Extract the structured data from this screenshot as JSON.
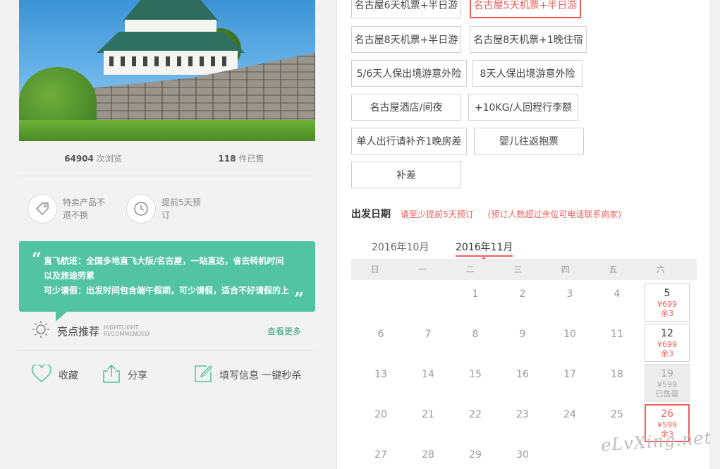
{
  "product": {
    "stats": {
      "views": "64904",
      "views_label": "次浏览",
      "sold": "118",
      "sold_label": "件已售"
    },
    "features": [
      {
        "icon": "tag-icon",
        "text": "特卖产品不退不换"
      },
      {
        "icon": "clock-icon",
        "text": "提前5天预订"
      }
    ],
    "quote_lines": [
      "直飞航班：全国多地直飞大阪/名古屋，一站直达，省去转机时间",
      "以及旅途劳累",
      "可少请假：出发时间包含端午假期，可少请假，适合不好请假的上"
    ],
    "highlight": {
      "title": "亮点推荐",
      "en1": "HIGHTLIGHT",
      "en2": "RECOMMENDED",
      "more": "查看更多"
    },
    "actions": {
      "favorite": "收藏",
      "share": "分享",
      "fill": "填写信息 一键秒杀"
    }
  },
  "options": [
    {
      "label": "名古屋6天机票+半日游",
      "selected": false
    },
    {
      "label": "名古屋5天机票+半日游",
      "selected": true
    },
    {
      "label": "名古屋8天机票+半日游",
      "selected": false
    },
    {
      "label": "名古屋8天机票+1晚住宿",
      "selected": false
    },
    {
      "label": "5/6天人保出境游意外险",
      "selected": false
    },
    {
      "label": "8天人保出境游意外险",
      "selected": false
    },
    {
      "label": "名古屋酒店/间夜",
      "selected": false
    },
    {
      "label": "+10KG/人回程行李额",
      "selected": false
    },
    {
      "label": "单人出行请补齐1晚房差",
      "selected": false
    },
    {
      "label": "婴儿往返抱票",
      "selected": false
    },
    {
      "label": "补差",
      "selected": false
    }
  ],
  "departure": {
    "title": "出发日期",
    "hint": "请至少提前5天预订",
    "hint2": "(预订人数超过余位可电话联系商家)",
    "months": [
      "2016年10月",
      "2016年11月"
    ],
    "active_month": "2016年11月",
    "weekdays": [
      "日",
      "一",
      "二",
      "三",
      "四",
      "五",
      "六"
    ],
    "days": [
      {
        "n": "1",
        "s": "none"
      },
      {
        "n": "2",
        "s": "none"
      },
      {
        "n": "3",
        "s": "none"
      },
      {
        "n": "4",
        "s": "none"
      },
      {
        "n": "5",
        "s": "avail",
        "price": "¥699",
        "left": "余3"
      },
      {
        "n": "6",
        "s": "none"
      },
      {
        "n": "7",
        "s": "none"
      },
      {
        "n": "8",
        "s": "none"
      },
      {
        "n": "9",
        "s": "none"
      },
      {
        "n": "10",
        "s": "none"
      },
      {
        "n": "11",
        "s": "none"
      },
      {
        "n": "12",
        "s": "avail",
        "price": "¥699",
        "left": "余3"
      },
      {
        "n": "13",
        "s": "none"
      },
      {
        "n": "14",
        "s": "none"
      },
      {
        "n": "15",
        "s": "none"
      },
      {
        "n": "16",
        "s": "none"
      },
      {
        "n": "17",
        "s": "none"
      },
      {
        "n": "18",
        "s": "none"
      },
      {
        "n": "19",
        "s": "sold",
        "price": "¥599",
        "left": "已售罄"
      },
      {
        "n": "20",
        "s": "none"
      },
      {
        "n": "21",
        "s": "none"
      },
      {
        "n": "22",
        "s": "none"
      },
      {
        "n": "23",
        "s": "none"
      },
      {
        "n": "24",
        "s": "none"
      },
      {
        "n": "25",
        "s": "none"
      },
      {
        "n": "26",
        "s": "picked",
        "price": "¥599",
        "left": "余3"
      },
      {
        "n": "27",
        "s": "none"
      },
      {
        "n": "28",
        "s": "none"
      },
      {
        "n": "29",
        "s": "none"
      },
      {
        "n": "30",
        "s": "none"
      }
    ],
    "first_weekday": 2
  },
  "watermark": "eLvXing.net",
  "colors": {
    "accent": "#ee5f5b",
    "green": "#52c4a0"
  }
}
